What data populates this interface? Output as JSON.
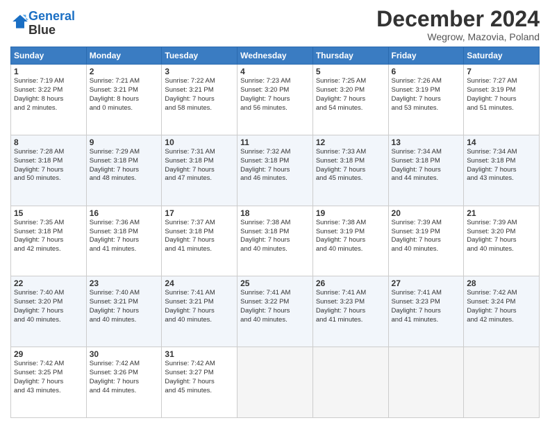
{
  "header": {
    "logo_line1": "General",
    "logo_line2": "Blue",
    "month": "December 2024",
    "location": "Wegrow, Mazovia, Poland"
  },
  "weekdays": [
    "Sunday",
    "Monday",
    "Tuesday",
    "Wednesday",
    "Thursday",
    "Friday",
    "Saturday"
  ],
  "weeks": [
    [
      {
        "day": "1",
        "lines": [
          "Sunrise: 7:19 AM",
          "Sunset: 3:22 PM",
          "Daylight: 8 hours",
          "and 2 minutes."
        ]
      },
      {
        "day": "2",
        "lines": [
          "Sunrise: 7:21 AM",
          "Sunset: 3:21 PM",
          "Daylight: 8 hours",
          "and 0 minutes."
        ]
      },
      {
        "day": "3",
        "lines": [
          "Sunrise: 7:22 AM",
          "Sunset: 3:21 PM",
          "Daylight: 7 hours",
          "and 58 minutes."
        ]
      },
      {
        "day": "4",
        "lines": [
          "Sunrise: 7:23 AM",
          "Sunset: 3:20 PM",
          "Daylight: 7 hours",
          "and 56 minutes."
        ]
      },
      {
        "day": "5",
        "lines": [
          "Sunrise: 7:25 AM",
          "Sunset: 3:20 PM",
          "Daylight: 7 hours",
          "and 54 minutes."
        ]
      },
      {
        "day": "6",
        "lines": [
          "Sunrise: 7:26 AM",
          "Sunset: 3:19 PM",
          "Daylight: 7 hours",
          "and 53 minutes."
        ]
      },
      {
        "day": "7",
        "lines": [
          "Sunrise: 7:27 AM",
          "Sunset: 3:19 PM",
          "Daylight: 7 hours",
          "and 51 minutes."
        ]
      }
    ],
    [
      {
        "day": "8",
        "lines": [
          "Sunrise: 7:28 AM",
          "Sunset: 3:18 PM",
          "Daylight: 7 hours",
          "and 50 minutes."
        ]
      },
      {
        "day": "9",
        "lines": [
          "Sunrise: 7:29 AM",
          "Sunset: 3:18 PM",
          "Daylight: 7 hours",
          "and 48 minutes."
        ]
      },
      {
        "day": "10",
        "lines": [
          "Sunrise: 7:31 AM",
          "Sunset: 3:18 PM",
          "Daylight: 7 hours",
          "and 47 minutes."
        ]
      },
      {
        "day": "11",
        "lines": [
          "Sunrise: 7:32 AM",
          "Sunset: 3:18 PM",
          "Daylight: 7 hours",
          "and 46 minutes."
        ]
      },
      {
        "day": "12",
        "lines": [
          "Sunrise: 7:33 AM",
          "Sunset: 3:18 PM",
          "Daylight: 7 hours",
          "and 45 minutes."
        ]
      },
      {
        "day": "13",
        "lines": [
          "Sunrise: 7:34 AM",
          "Sunset: 3:18 PM",
          "Daylight: 7 hours",
          "and 44 minutes."
        ]
      },
      {
        "day": "14",
        "lines": [
          "Sunrise: 7:34 AM",
          "Sunset: 3:18 PM",
          "Daylight: 7 hours",
          "and 43 minutes."
        ]
      }
    ],
    [
      {
        "day": "15",
        "lines": [
          "Sunrise: 7:35 AM",
          "Sunset: 3:18 PM",
          "Daylight: 7 hours",
          "and 42 minutes."
        ]
      },
      {
        "day": "16",
        "lines": [
          "Sunrise: 7:36 AM",
          "Sunset: 3:18 PM",
          "Daylight: 7 hours",
          "and 41 minutes."
        ]
      },
      {
        "day": "17",
        "lines": [
          "Sunrise: 7:37 AM",
          "Sunset: 3:18 PM",
          "Daylight: 7 hours",
          "and 41 minutes."
        ]
      },
      {
        "day": "18",
        "lines": [
          "Sunrise: 7:38 AM",
          "Sunset: 3:18 PM",
          "Daylight: 7 hours",
          "and 40 minutes."
        ]
      },
      {
        "day": "19",
        "lines": [
          "Sunrise: 7:38 AM",
          "Sunset: 3:19 PM",
          "Daylight: 7 hours",
          "and 40 minutes."
        ]
      },
      {
        "day": "20",
        "lines": [
          "Sunrise: 7:39 AM",
          "Sunset: 3:19 PM",
          "Daylight: 7 hours",
          "and 40 minutes."
        ]
      },
      {
        "day": "21",
        "lines": [
          "Sunrise: 7:39 AM",
          "Sunset: 3:20 PM",
          "Daylight: 7 hours",
          "and 40 minutes."
        ]
      }
    ],
    [
      {
        "day": "22",
        "lines": [
          "Sunrise: 7:40 AM",
          "Sunset: 3:20 PM",
          "Daylight: 7 hours",
          "and 40 minutes."
        ]
      },
      {
        "day": "23",
        "lines": [
          "Sunrise: 7:40 AM",
          "Sunset: 3:21 PM",
          "Daylight: 7 hours",
          "and 40 minutes."
        ]
      },
      {
        "day": "24",
        "lines": [
          "Sunrise: 7:41 AM",
          "Sunset: 3:21 PM",
          "Daylight: 7 hours",
          "and 40 minutes."
        ]
      },
      {
        "day": "25",
        "lines": [
          "Sunrise: 7:41 AM",
          "Sunset: 3:22 PM",
          "Daylight: 7 hours",
          "and 40 minutes."
        ]
      },
      {
        "day": "26",
        "lines": [
          "Sunrise: 7:41 AM",
          "Sunset: 3:23 PM",
          "Daylight: 7 hours",
          "and 41 minutes."
        ]
      },
      {
        "day": "27",
        "lines": [
          "Sunrise: 7:41 AM",
          "Sunset: 3:23 PM",
          "Daylight: 7 hours",
          "and 41 minutes."
        ]
      },
      {
        "day": "28",
        "lines": [
          "Sunrise: 7:42 AM",
          "Sunset: 3:24 PM",
          "Daylight: 7 hours",
          "and 42 minutes."
        ]
      }
    ],
    [
      {
        "day": "29",
        "lines": [
          "Sunrise: 7:42 AM",
          "Sunset: 3:25 PM",
          "Daylight: 7 hours",
          "and 43 minutes."
        ]
      },
      {
        "day": "30",
        "lines": [
          "Sunrise: 7:42 AM",
          "Sunset: 3:26 PM",
          "Daylight: 7 hours",
          "and 44 minutes."
        ]
      },
      {
        "day": "31",
        "lines": [
          "Sunrise: 7:42 AM",
          "Sunset: 3:27 PM",
          "Daylight: 7 hours",
          "and 45 minutes."
        ]
      },
      null,
      null,
      null,
      null
    ]
  ]
}
